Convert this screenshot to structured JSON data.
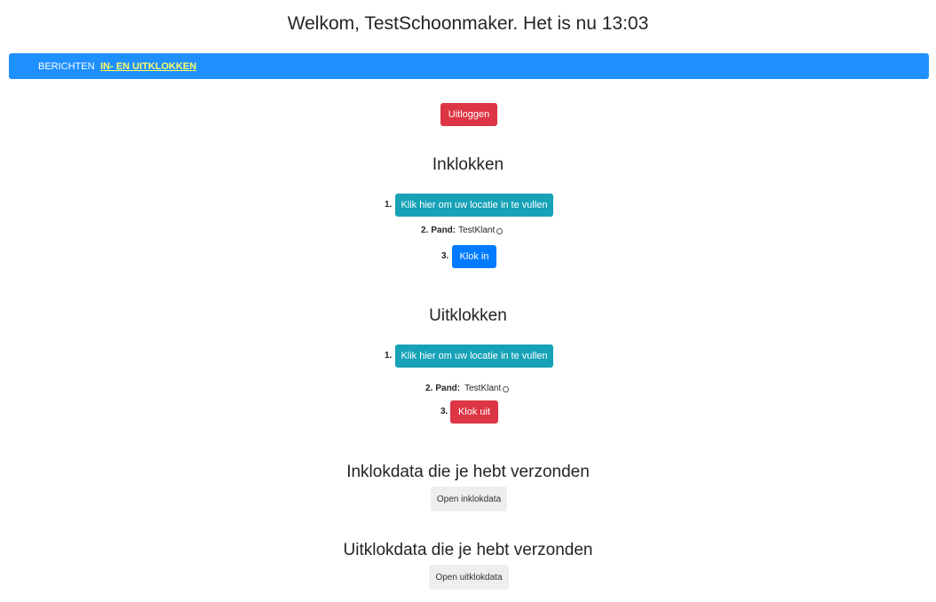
{
  "header": {
    "welcome_text": "Welkom, TestSchoonmaker. Het is nu 13:03"
  },
  "nav": {
    "items": [
      {
        "label": "Berichten",
        "active": false
      },
      {
        "label": "In- en uitklokken",
        "active": true
      }
    ]
  },
  "logout": {
    "label": "Uitloggen"
  },
  "inklokken": {
    "title": "Inklokken",
    "step1_num": "1.",
    "location_button": "Klik hier om uw locatie in te vullen",
    "step2_num": "2.",
    "pand_label": "Pand:",
    "pand_value": "TestKlant",
    "step3_num": "3.",
    "action_button": "Klok in"
  },
  "uitklokken": {
    "title": "Uitklokken",
    "step1_num": "1.",
    "location_button": "Klik hier om uw locatie in te vullen",
    "step2_num": "2.",
    "pand_label": "Pand:",
    "pand_value": "TestKlant",
    "step3_num": "3.",
    "action_button": "Klok uit"
  },
  "inklokdata": {
    "title": "Inklokdata die je hebt verzonden",
    "button": "Open inklokdata"
  },
  "uitklokdata": {
    "title": "Uitklokdata die je hebt verzonden",
    "button": "Open uitklokdata"
  },
  "colors": {
    "nav_bg": "#1e90ff",
    "nav_active": "#ffff66",
    "danger": "#dc3545",
    "info": "#17a2b8",
    "primary": "#007bff",
    "light": "#eeeeee"
  }
}
